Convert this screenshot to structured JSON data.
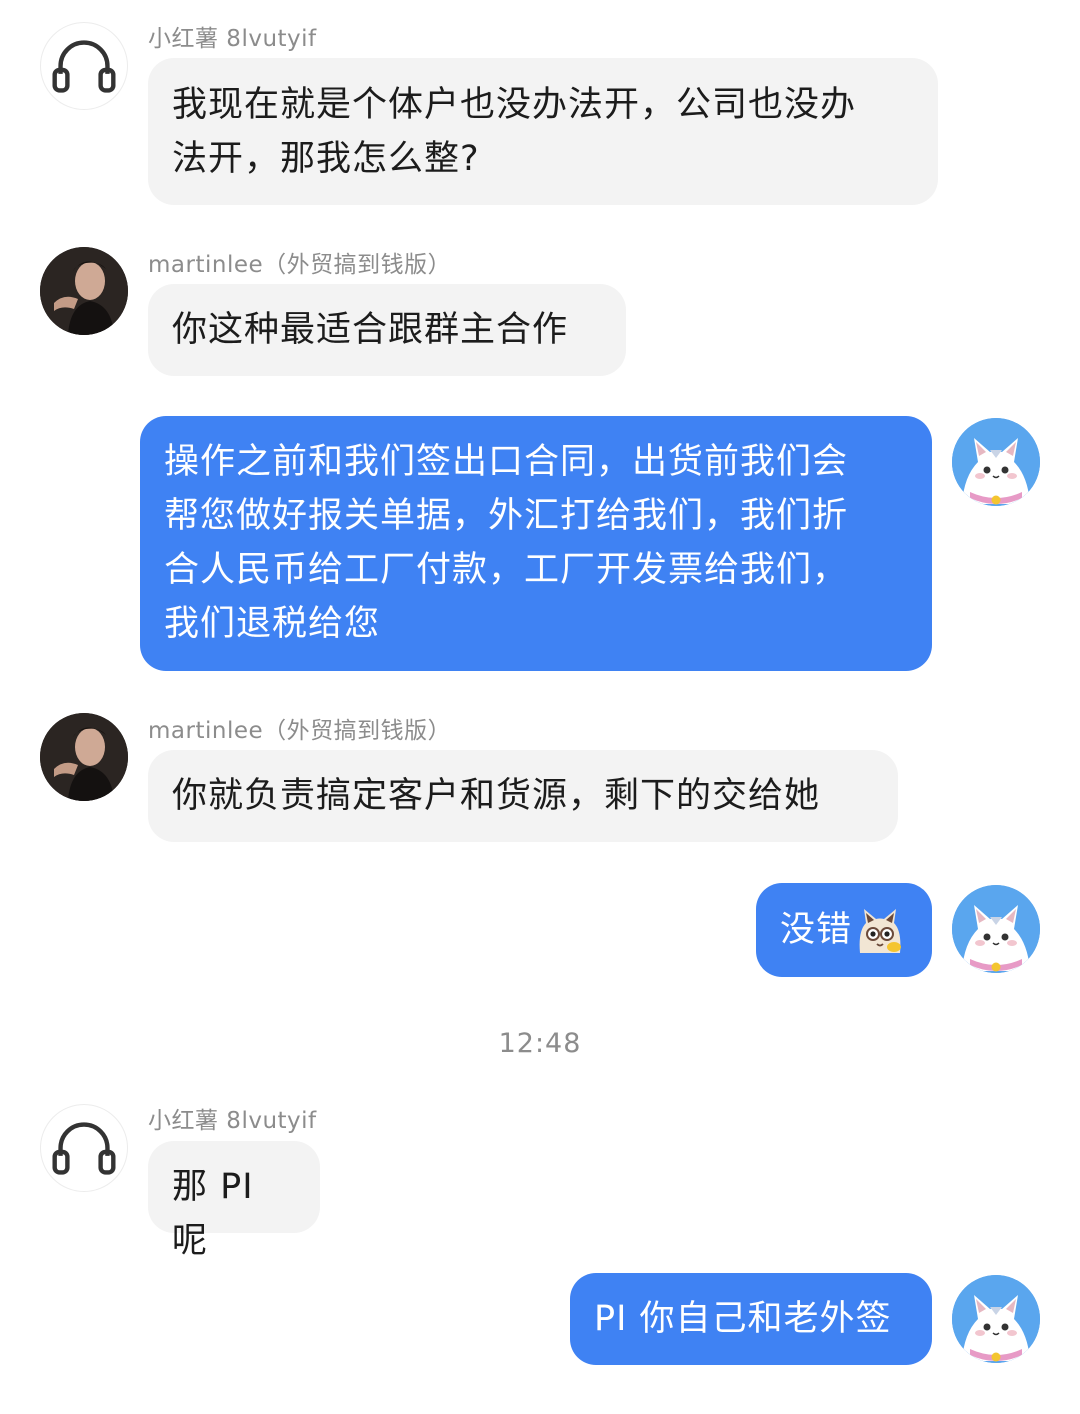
{
  "messages": [
    {
      "sender": "小红薯 8lvutyif",
      "avatar": "headphones-avatar-icon",
      "line1": "我现在就是个体户也没办法开，公司也没办",
      "line2": "法开，那我怎么整?"
    },
    {
      "sender": "martinlee（外贸搞到钱版）",
      "avatar": "man-photo-avatar",
      "text": "你这种最适合跟群主合作"
    },
    {
      "avatar": "cat-avatar-icon",
      "line1": "操作之前和我们签出口合同，出货前我们会",
      "line2": "帮您做好报关单据，外汇打给我们，我们折",
      "line3": "合人民币给工厂付款，工厂开发票给我们，",
      "line4": "我们退税给您"
    },
    {
      "sender": "martinlee（外贸搞到钱版）",
      "avatar": "man-photo-avatar",
      "text": "你就负责搞定客户和货源，剩下的交给她"
    },
    {
      "avatar": "cat-avatar-icon",
      "text": "没错",
      "sticker": "cat-emoji-icon"
    },
    {
      "sender": "小红薯 8lvutyif",
      "avatar": "headphones-avatar-icon",
      "text": "那 PI 呢"
    },
    {
      "avatar": "cat-avatar-icon",
      "text": "PI 你自己和老外签"
    }
  ],
  "timestamp": "12:48",
  "colors": {
    "outgoing_bubble": "#3f82f3",
    "incoming_bubble": "#f3f3f3",
    "meta_text": "#8c8c8c"
  }
}
